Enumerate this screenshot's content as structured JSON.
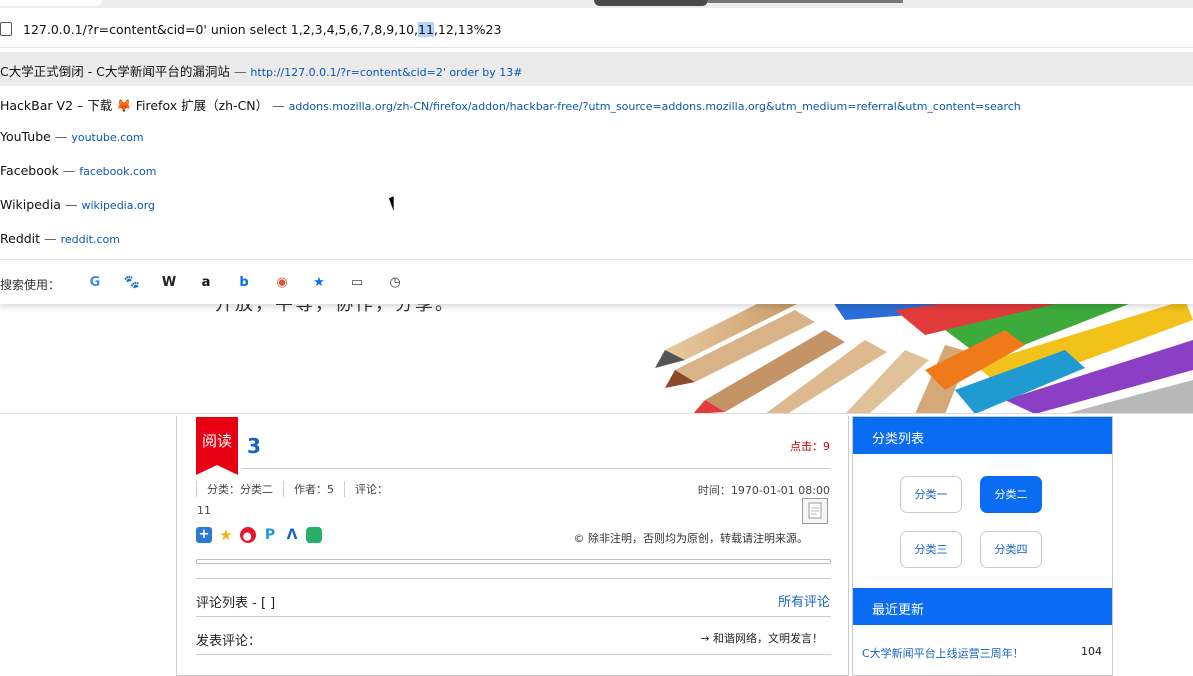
{
  "browser": {
    "url": "127.0.0.1/?r=content&cid=0' union select 1,2,3,4,5,6,7,8,9,10,",
    "url_selected": "11",
    "url_tail": ",12,13%23",
    "suggestions": [
      {
        "title": "C大学正式倒闭 - C大学新闻平台的漏洞站",
        "url": "http://127.0.0.1/?r=content&cid=2' order by 13#"
      },
      {
        "title": "HackBar V2 – 下载 🦊 Firefox 扩展（zh-CN）",
        "url": "addons.mozilla.org/zh-CN/firefox/addon/hackbar-free/?utm_source=addons.mozilla.org&utm_medium=referral&utm_content=search"
      },
      {
        "title": "YouTube",
        "url": "youtube.com"
      },
      {
        "title": "Facebook",
        "url": "facebook.com"
      },
      {
        "title": "Wikipedia",
        "url": "wikipedia.org"
      },
      {
        "title": "Reddit",
        "url": "reddit.com"
      }
    ],
    "search_with_label": "搜索使用：",
    "search_engines": [
      {
        "name": "google-icon",
        "glyph": "G",
        "color": "#4285f4"
      },
      {
        "name": "baidu-icon",
        "glyph": "🐾",
        "color": "#2932e1"
      },
      {
        "name": "wikipedia-icon",
        "glyph": "W",
        "color": "#222"
      },
      {
        "name": "amazon-icon",
        "glyph": "a",
        "color": "#111"
      },
      {
        "name": "bing-icon",
        "glyph": "b",
        "color": "#0a6cf2"
      },
      {
        "name": "duckduckgo-icon",
        "glyph": "◉",
        "color": "#de5833"
      },
      {
        "name": "bookmarks-star-icon",
        "glyph": "★",
        "color": "#0a6cf2"
      },
      {
        "name": "tabs-icon",
        "glyph": "▭",
        "color": "#444"
      },
      {
        "name": "history-icon",
        "glyph": "◷",
        "color": "#444"
      }
    ]
  },
  "page": {
    "banner_text": "开放，平等，协作，分享。",
    "read_badge": "阅读",
    "article_title": "3",
    "clicks": "点击：9",
    "meta_category": "分类：分类二",
    "meta_author": "作者：5",
    "meta_comments": "评论：",
    "meta_value": "11",
    "time": "时间：1970-01-01 08:00",
    "copyright": "© 除非注明，否则均为原创，转载请注明来源。",
    "comments_title": "评论列表 - [ ]",
    "all_comments": "所有评论",
    "post_comment": "发表评论：",
    "civil_note": "→ 和谐网络，文明发言！"
  },
  "sidebar": {
    "categories_title": "分类列表",
    "categories": [
      "分类一",
      "分类二",
      "分类三",
      "分类四"
    ],
    "active_category": "分类二",
    "recent_title": "最近更新",
    "recent_item": "C大学新闻平台上线运营三周年！",
    "recent_count": "104"
  },
  "colors": {
    "accent": "#0a6cf2",
    "badge_red": "#e60012",
    "link": "#1565c0"
  }
}
